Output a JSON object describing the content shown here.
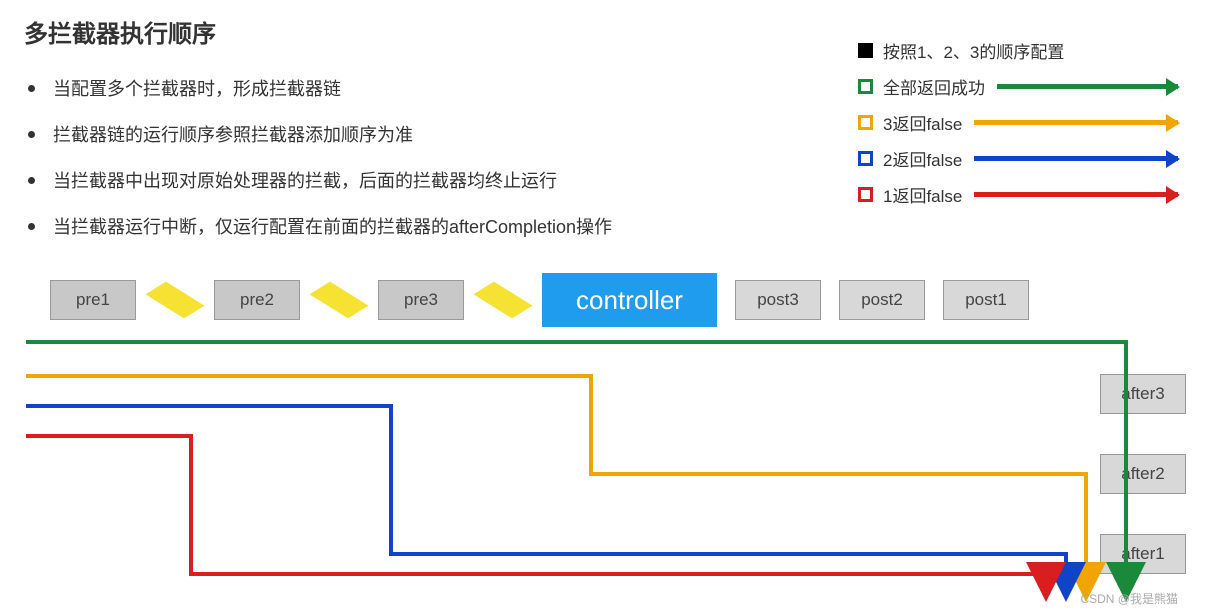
{
  "title": "多拦截器执行顺序",
  "bullets": [
    "当配置多个拦截器时，形成拦截器链",
    "拦截器链的运行顺序参照拦截器添加顺序为准",
    "当拦截器中出现对原始处理器的拦截，后面的拦截器均终止运行",
    "当拦截器运行中断，仅运行配置在前面的拦截器的afterCompletion操作"
  ],
  "legend": [
    {
      "label": "按照1、2、3的顺序配置",
      "color": "#000000",
      "filled": true,
      "arrow": false
    },
    {
      "label": "全部返回成功",
      "color": "#1a8a3a",
      "filled": false,
      "arrow": true
    },
    {
      "label": "3返回false",
      "color": "#f0a500",
      "filled": false,
      "arrow": true
    },
    {
      "label": "2返回false",
      "color": "#1044c8",
      "filled": false,
      "arrow": true
    },
    {
      "label": "1返回false",
      "color": "#d81e1e",
      "filled": false,
      "arrow": true
    }
  ],
  "nodes": {
    "pre": [
      "pre1",
      "pre2",
      "pre3"
    ],
    "controller": "controller",
    "post": [
      "post3",
      "post2",
      "post1"
    ],
    "after": [
      "after3",
      "after2",
      "after1"
    ]
  },
  "colors": {
    "green": "#1a8a3a",
    "orange": "#f0a500",
    "blue": "#1044c8",
    "red": "#d81e1e"
  },
  "chart_data": {
    "type": "diagram",
    "flow_sequence": [
      "pre1",
      "pre2",
      "pre3",
      "controller",
      "post3",
      "post2",
      "post1",
      "after3",
      "after2",
      "after1"
    ],
    "paths": [
      {
        "name": "全部返回成功",
        "color": "green",
        "reaches": "after1",
        "via": [
          "pre1",
          "pre2",
          "pre3",
          "controller",
          "post3",
          "post2",
          "post1",
          "after3",
          "after2",
          "after1"
        ]
      },
      {
        "name": "3返回false",
        "color": "orange",
        "fail_at": "pre3",
        "then": [
          "after2",
          "after1"
        ]
      },
      {
        "name": "2返回false",
        "color": "blue",
        "fail_at": "pre2",
        "then": [
          "after1"
        ]
      },
      {
        "name": "1返回false",
        "color": "red",
        "fail_at": "pre1",
        "then": []
      }
    ]
  },
  "watermark": "CSDN @我是熊猫"
}
